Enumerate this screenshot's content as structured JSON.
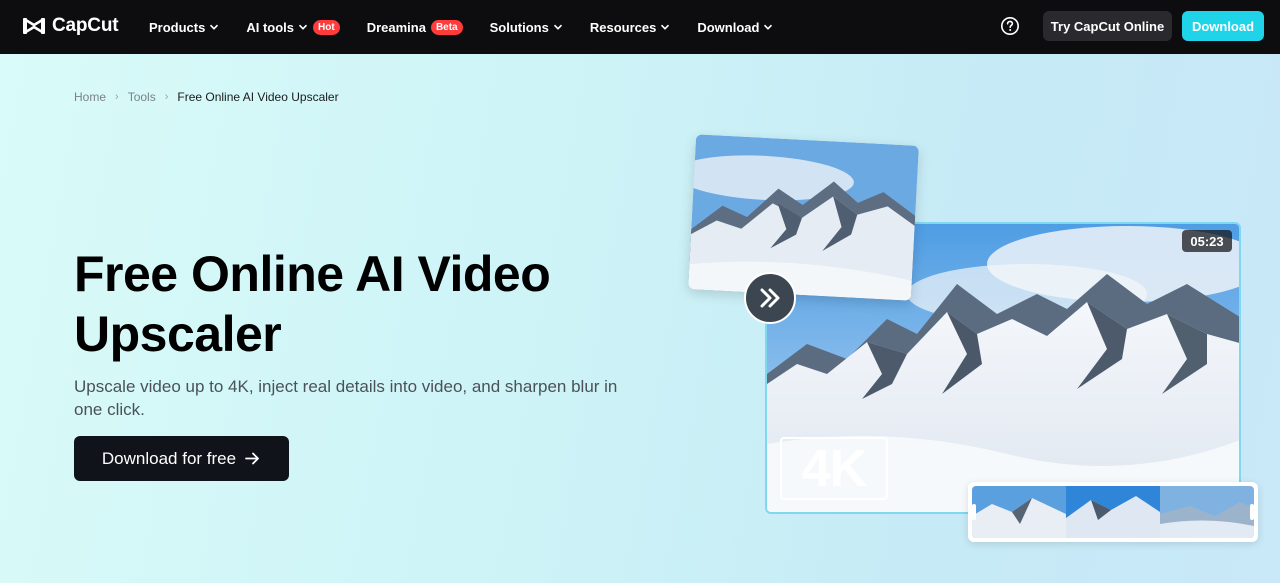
{
  "nav": {
    "logo_text": "CapCut",
    "items": [
      {
        "label": "Products",
        "badge": ""
      },
      {
        "label": "AI tools",
        "badge": "Hot"
      },
      {
        "label": "Dreamina",
        "badge": "Beta"
      },
      {
        "label": "Solutions",
        "badge": ""
      },
      {
        "label": "Resources",
        "badge": ""
      },
      {
        "label": "Download",
        "badge": ""
      }
    ],
    "try_online_label": "Try CapCut Online",
    "download_label": "Download"
  },
  "breadcrumb": {
    "home": "Home",
    "tools": "Tools",
    "current": "Free Online AI Video Upscaler"
  },
  "hero": {
    "title": "Free Online AI Video Upscaler",
    "subtitle": "Upscale video up to 4K, inject real details into video, and sharpen blur in one click.",
    "cta_label": "Download for free",
    "duration": "05:23",
    "resolution_label": "4K"
  },
  "colors": {
    "nav_bg": "#0d0d0f",
    "accent": "#1fd3e9",
    "hot_badge": "#ff3b3b",
    "cta_bg": "#10131a"
  }
}
